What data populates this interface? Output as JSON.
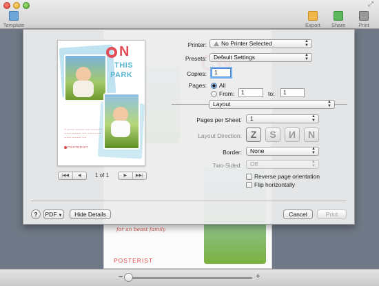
{
  "toolbar": {
    "template_label": "Template",
    "export_label": "Export",
    "share_label": "Share",
    "print_label": "Print"
  },
  "canvas": {
    "title_fragment": "CN",
    "note": "for an beast family",
    "brand": "POSTERIST"
  },
  "preview": {
    "logo_letter": "N",
    "line1": "THIS",
    "line2": "PARK",
    "brand": "POSTERIST",
    "page_counter": "1 of 1",
    "nav_first": "|◀◀",
    "nav_prev": "◀",
    "nav_next": "▶",
    "nav_last": "▶▶|"
  },
  "print": {
    "printer_label": "Printer:",
    "printer_value": "No Printer Selected",
    "presets_label": "Presets:",
    "presets_value": "Default Settings",
    "copies_label": "Copies:",
    "copies_value": "1",
    "pages_label": "Pages:",
    "pages_all": "All",
    "pages_from": "From:",
    "from_value": "1",
    "to_label": "to:",
    "to_value": "1",
    "section_value": "Layout",
    "pages_per_sheet_label": "Pages per Sheet:",
    "pages_per_sheet_value": "1",
    "layout_direction_label": "Layout Direction:",
    "border_label": "Border:",
    "border_value": "None",
    "two_sided_label": "Two-Sided:",
    "two_sided_value": "Off",
    "reverse_label": "Reverse page orientation",
    "flip_label": "Flip horizontally",
    "help": "?",
    "pdf": "PDF",
    "hide_details": "Hide Details",
    "cancel": "Cancel",
    "print": "Print"
  },
  "icons": [
    "template-icon",
    "export-icon",
    "share-icon",
    "print-icon",
    "warning-icon",
    "help-icon",
    "chevron-updown-icon"
  ]
}
